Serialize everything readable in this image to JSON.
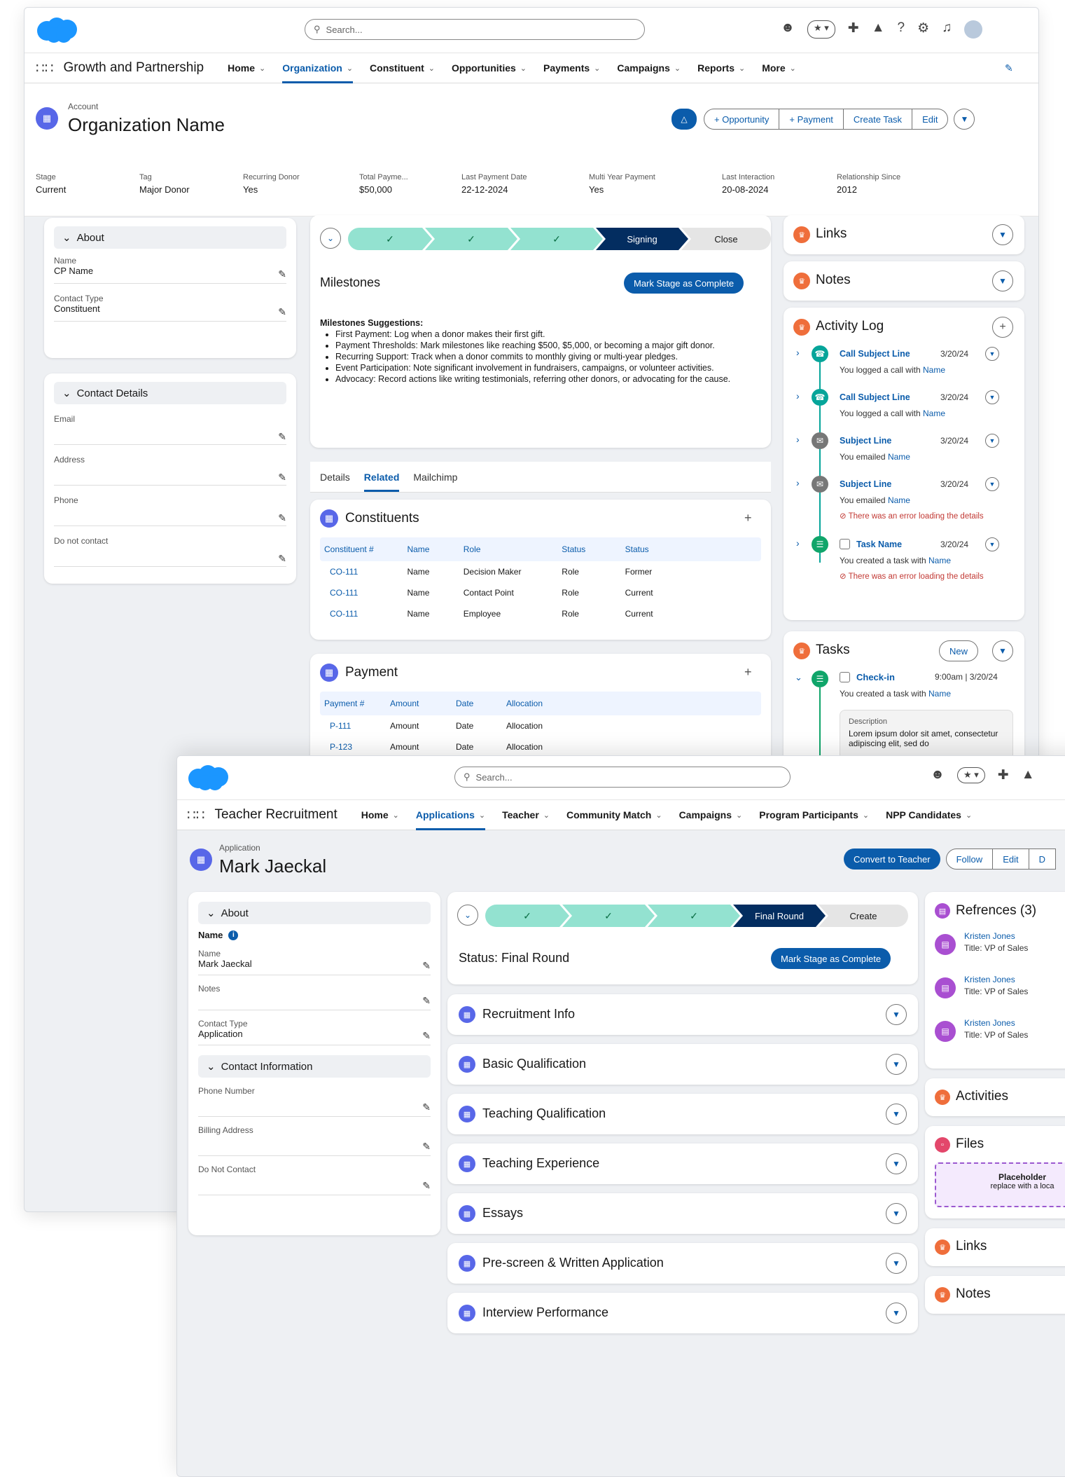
{
  "w1": {
    "search": "Search...",
    "app": "Growth and Partnership",
    "nav": [
      "Home",
      "Organization",
      "Constituent",
      "Opportunities",
      "Payments",
      "Campaigns",
      "Reports",
      "More"
    ],
    "obj_type": "Account",
    "title": "Organization Name",
    "actions": [
      "+ Opportunity",
      "+ Payment",
      "Create Task",
      "Edit"
    ],
    "highlights": [
      {
        "label": "Stage",
        "value": "Current"
      },
      {
        "label": "Tag",
        "value": "Major Donor"
      },
      {
        "label": "Recurring Donor",
        "value": "Yes"
      },
      {
        "label": "Total Payme...",
        "value": "$50,000"
      },
      {
        "label": "Last Payment Date",
        "value": "22-12-2024"
      },
      {
        "label": "Multi Year Payment",
        "value": "Yes"
      },
      {
        "label": "Last Interaction",
        "value": "20-08-2024"
      },
      {
        "label": "Relationship Since",
        "value": "2012"
      }
    ],
    "about": {
      "title": "About",
      "name_label": "Name",
      "name_value": "CP Name",
      "ctype_label": "Contact Type",
      "ctype_value": "Constituent"
    },
    "contact": {
      "title": "Contact Details",
      "fields": [
        "Email",
        "Address",
        "Phone",
        "Do not contact"
      ]
    },
    "path": {
      "steps": [
        "✓",
        "✓",
        "✓",
        "Signing",
        "Close"
      ]
    },
    "milestones": {
      "title": "Milestones",
      "button": "Mark Stage as Complete",
      "heading": "Milestones Suggestions:",
      "items": [
        "First Payment: Log when a donor makes their first gift.",
        "Payment Thresholds: Mark milestones like reaching $500, $5,000, or becoming a major gift donor.",
        "Recurring Support: Track when a donor commits to monthly giving or multi-year pledges.",
        "Event Participation: Note significant involvement in fundraisers, campaigns, or volunteer activities.",
        "Advocacy: Record actions like writing testimonials, referring other donors, or advocating for the cause."
      ]
    },
    "tabs": [
      "Details",
      "Related",
      "Mailchimp"
    ],
    "constituents": {
      "title": "Constituents",
      "cols": [
        "Constituent #",
        "Name",
        "Role",
        "Status",
        "Status"
      ],
      "rows": [
        [
          "CO-111",
          "Name",
          "Decision Maker",
          "Role",
          "Former"
        ],
        [
          "CO-111",
          "Name",
          "Contact Point",
          "Role",
          "Current"
        ],
        [
          "CO-111",
          "Name",
          "Employee",
          "Role",
          "Current"
        ]
      ]
    },
    "payment": {
      "title": "Payment",
      "cols": [
        "Payment #",
        "Amount",
        "Date",
        "Allocation"
      ],
      "rows": [
        [
          "P-111",
          "Amount",
          "Date",
          "Allocation"
        ],
        [
          "P-123",
          "Amount",
          "Date",
          "Allocation"
        ]
      ]
    },
    "links": "Links",
    "notes": "Notes",
    "activity": {
      "title": "Activity Log",
      "items": [
        {
          "subject": "Call Subject Line",
          "date": "3/20/24",
          "desc": "You logged a call with",
          "name": "Name",
          "error": ""
        },
        {
          "subject": "Call Subject Line",
          "date": "3/20/24",
          "desc": "You logged a call with",
          "name": "Name",
          "error": ""
        },
        {
          "subject": "Subject Line",
          "date": "3/20/24",
          "desc": "You emailed",
          "name": "Name",
          "error": ""
        },
        {
          "subject": "Subject Line",
          "date": "3/20/24",
          "desc": "You emailed",
          "name": "Name",
          "error": "There was an error loading the details"
        },
        {
          "subject": "Task Name",
          "date": "3/20/24",
          "desc": "You created a task with",
          "name": "Name",
          "error": "There was an error loading the details"
        }
      ]
    },
    "tasks": {
      "title": "Tasks",
      "new": "New",
      "item": "Check-in",
      "time": "9:00am | 3/20/24",
      "desc": "You created a task with",
      "name": "Name",
      "desc_label": "Description",
      "desc_text": "Lorem ipsum dolor sit amet, consectetur adipiscing elit, sed do"
    }
  },
  "w2": {
    "search": "Search...",
    "app": "Teacher Recruitment",
    "nav": [
      "Home",
      "Applications",
      "Teacher",
      "Community Match",
      "Campaigns",
      "Program Participants",
      "NPP Candidates"
    ],
    "obj_type": "Application",
    "title": "Mark Jaeckal",
    "actions": [
      "Convert to Teacher",
      "Follow",
      "Edit",
      "D"
    ],
    "about": {
      "title": "About",
      "name_bold": "Name",
      "fields": [
        {
          "label": "Name",
          "value": "Mark Jaeckal"
        },
        {
          "label": "Notes",
          "value": ""
        },
        {
          "label": "Contact Type",
          "value": "Application"
        }
      ]
    },
    "contact": {
      "title": "Contact Information",
      "fields": [
        "Phone Number",
        "Billing Address",
        "Do Not Contact"
      ]
    },
    "path": {
      "steps": [
        "✓",
        "✓",
        "✓",
        "Final Round",
        "Create"
      ]
    },
    "status": {
      "title": "Status: Final Round",
      "button": "Mark Stage as Complete"
    },
    "sections": [
      "Recruitment Info",
      "Basic Qualification",
      "Teaching Qualification",
      "Teaching Experience",
      "Essays",
      "Pre-screen & Written Application",
      "Interview Performance"
    ],
    "refs": {
      "title": "Refrences (3)",
      "items": [
        {
          "name": "Kristen Jones",
          "title": "Title: VP of Sales"
        },
        {
          "name": "Kristen Jones",
          "title": "Title: VP of Sales"
        },
        {
          "name": "Kristen Jones",
          "title": "Title: VP of Sales"
        }
      ]
    },
    "activities": "Activities",
    "files": {
      "title": "Files",
      "ph1": "Placeholder",
      "ph2": "replace with a loca"
    },
    "links": "Links",
    "notes": "Notes"
  }
}
